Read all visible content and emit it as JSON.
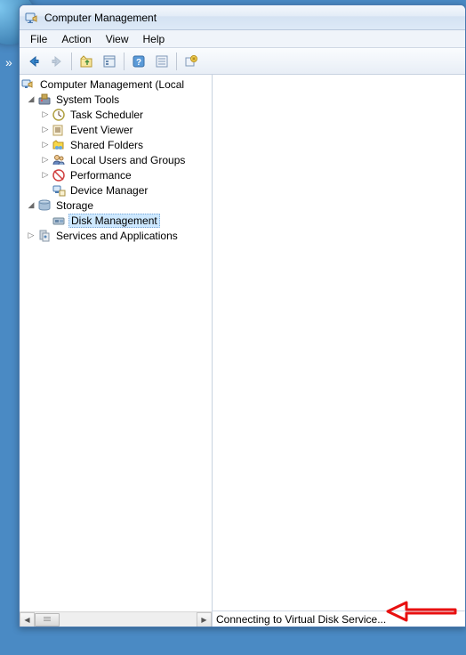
{
  "window": {
    "title": "Computer Management"
  },
  "menu": {
    "items": [
      "File",
      "Action",
      "View",
      "Help"
    ]
  },
  "tree": {
    "root": "Computer Management (Local",
    "system_tools": {
      "label": "System Tools",
      "children": [
        "Task Scheduler",
        "Event Viewer",
        "Shared Folders",
        "Local Users and Groups",
        "Performance",
        "Device Manager"
      ]
    },
    "storage": {
      "label": "Storage",
      "children": [
        "Disk Management"
      ]
    },
    "services": {
      "label": "Services and Applications"
    }
  },
  "status": {
    "text": "Connecting to Virtual Disk Service..."
  }
}
